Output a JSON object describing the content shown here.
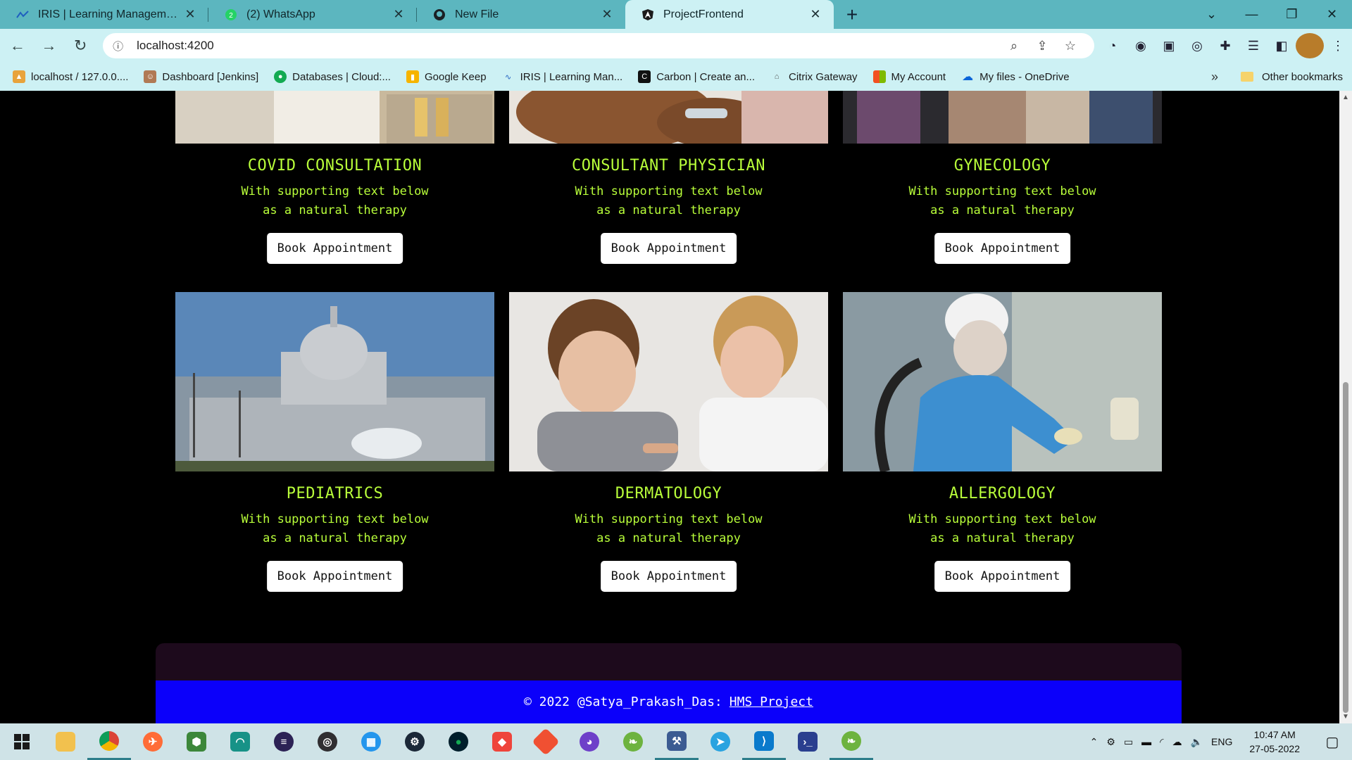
{
  "tabs": [
    {
      "title": "IRIS | Learning Management Syst",
      "icon": "iris-icon",
      "active": false
    },
    {
      "title": "(2) WhatsApp",
      "icon": "whatsapp-icon",
      "active": false
    },
    {
      "title": "New File",
      "icon": "github-icon",
      "active": false
    },
    {
      "title": "ProjectFrontend",
      "icon": "angular-icon",
      "active": true
    }
  ],
  "address": {
    "url": "localhost:4200"
  },
  "bookmarks": [
    "localhost / 127.0.0....",
    "Dashboard [Jenkins]",
    "Databases | Cloud:...",
    "Google Keep",
    "IRIS | Learning Man...",
    "Carbon | Create an...",
    "Citrix Gateway",
    "My Account",
    "My files - OneDrive"
  ],
  "bookmarks_more": "»",
  "bookmarks_other": "Other bookmarks",
  "cards": [
    {
      "name": "COVID CONSULTATION",
      "desc": "With supporting text below as a natural therapy",
      "button": "Book Appointment"
    },
    {
      "name": "CONSULTANT PHYSICIAN",
      "desc": "With supporting text below as a natural therapy",
      "button": "Book Appointment"
    },
    {
      "name": "GYNECOLOGY",
      "desc": "With supporting text below as a natural therapy",
      "button": "Book Appointment"
    },
    {
      "name": "PEDIATRICS",
      "desc": "With supporting text below as a natural therapy",
      "button": "Book Appointment"
    },
    {
      "name": "DERMATOLOGY",
      "desc": "With supporting text below as a natural therapy",
      "button": "Book Appointment"
    },
    {
      "name": "ALLERGOLOGY",
      "desc": "With supporting text below as a natural therapy",
      "button": "Book Appointment"
    }
  ],
  "footer": {
    "text": "© 2022 @Satya_Prakash_Das:",
    "link": "HMS Project"
  },
  "taskbar": {
    "lang": "ENG",
    "time": "10:47 AM",
    "date": "27-05-2022"
  },
  "colors": {
    "accent_text": "#b9ff3a",
    "footer_blue": "#0b00fa",
    "chrome": "#5cb6bf"
  }
}
